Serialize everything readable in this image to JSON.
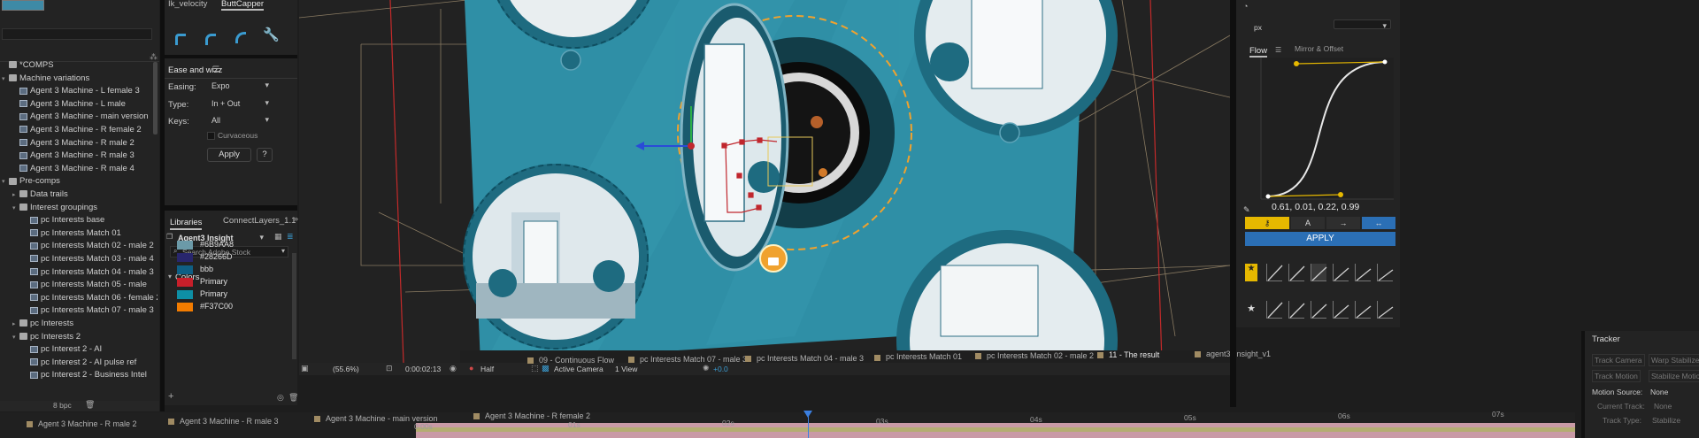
{
  "project_panel": {
    "search_placeholder": "",
    "items": [
      {
        "label": "*COMPS",
        "indent": 0,
        "type": "folder",
        "twirl": ""
      },
      {
        "label": "Machine variations",
        "indent": 0,
        "type": "folder",
        "twirl": "▾"
      },
      {
        "label": "Agent 3 Machine - L female 3",
        "indent": 1,
        "type": "comp",
        "twirl": ""
      },
      {
        "label": "Agent 3 Machine - L male",
        "indent": 1,
        "type": "comp",
        "twirl": ""
      },
      {
        "label": "Agent 3 Machine - main version",
        "indent": 1,
        "type": "comp",
        "twirl": ""
      },
      {
        "label": "Agent 3 Machine - R female 2",
        "indent": 1,
        "type": "comp",
        "twirl": ""
      },
      {
        "label": "Agent 3 Machine - R male 2",
        "indent": 1,
        "type": "comp",
        "twirl": ""
      },
      {
        "label": "Agent 3 Machine - R male 3",
        "indent": 1,
        "type": "comp",
        "twirl": ""
      },
      {
        "label": "Agent 3 Machine - R male 4",
        "indent": 1,
        "type": "comp",
        "twirl": ""
      },
      {
        "label": "Pre-comps",
        "indent": 0,
        "type": "folder",
        "twirl": "▾"
      },
      {
        "label": "Data trails",
        "indent": 1,
        "type": "folder",
        "twirl": "▸"
      },
      {
        "label": "Interest groupings",
        "indent": 1,
        "type": "folder",
        "twirl": "▾"
      },
      {
        "label": "pc Interests base",
        "indent": 2,
        "type": "comp",
        "twirl": ""
      },
      {
        "label": "pc Interests Match 01",
        "indent": 2,
        "type": "comp",
        "twirl": ""
      },
      {
        "label": "pc Interests Match 02 - male 2",
        "indent": 2,
        "type": "comp",
        "twirl": ""
      },
      {
        "label": "pc Interests Match 03 - male 4",
        "indent": 2,
        "type": "comp",
        "twirl": ""
      },
      {
        "label": "pc Interests Match 04 - male 3",
        "indent": 2,
        "type": "comp",
        "twirl": ""
      },
      {
        "label": "pc Interests Match 05 - male",
        "indent": 2,
        "type": "comp",
        "twirl": ""
      },
      {
        "label": "pc Interests Match 06 - female 2",
        "indent": 2,
        "type": "comp",
        "twirl": ""
      },
      {
        "label": "pc Interests Match 07 - male 3",
        "indent": 2,
        "type": "comp",
        "twirl": ""
      },
      {
        "label": "pc Interests",
        "indent": 1,
        "type": "folder",
        "twirl": "▸"
      },
      {
        "label": "pc Interests 2",
        "indent": 1,
        "type": "folder",
        "twirl": "▾"
      },
      {
        "label": "pc Interest 2 - AI",
        "indent": 2,
        "type": "comp",
        "twirl": ""
      },
      {
        "label": "pc Interest 2 - AI pulse ref",
        "indent": 2,
        "type": "comp",
        "twirl": ""
      },
      {
        "label": "pc Interest 2 - Business Intel",
        "indent": 2,
        "type": "comp",
        "twirl": ""
      }
    ],
    "footer_bpc": "8 bpc"
  },
  "scripts_panel": {
    "tabs": [
      "Ik_velocity",
      "ButtCapper"
    ],
    "tool_icons": [
      "corner-icon-1",
      "corner-icon-2",
      "corner-icon-3",
      "wrench-icon"
    ]
  },
  "ease_panel": {
    "title": "Ease and wizz",
    "easing_label": "Easing:",
    "easing_value": "Expo",
    "type_label": "Type:",
    "type_value": "In + Out",
    "keys_label": "Keys:",
    "keys_value": "All",
    "curvaceous_label": "Curvaceous",
    "apply_label": "Apply",
    "help_label": "?"
  },
  "libraries_panel": {
    "tabs": [
      "Libraries",
      "ConnectLayers_1.1"
    ],
    "library_name": "Agent3 Insight",
    "search_placeholder": "Search Adobe Stock",
    "section": "Colors",
    "colors": [
      {
        "label": "#6B9AA8",
        "hex": "#6B9AA8"
      },
      {
        "label": "#28266D",
        "hex": "#28266D"
      },
      {
        "label": "bbb",
        "hex": "#0F5F84"
      },
      {
        "label": "Primary",
        "hex": "#C81F2A"
      },
      {
        "label": "Primary",
        "hex": "#0E8FA5"
      },
      {
        "label": "#F37C00",
        "hex": "#F37C00"
      }
    ]
  },
  "viewer": {
    "zoom": "(55.6%)",
    "timecode": "0:00:02:13",
    "resolution": "Half",
    "camera": "Active Camera",
    "views": "1 View",
    "exposure": "+0.0"
  },
  "flow_panel": {
    "tabs": [
      "Flow",
      "Mirror & Offset"
    ],
    "unit": "px",
    "curve_values": "0.61, 0.01, 0.22, 0.99",
    "apply_label": "APPLY",
    "accent": "#2B6FB5"
  },
  "tracker_panel": {
    "title": "Tracker",
    "buttons": [
      "Track Camera",
      "Warp Stabilizer",
      "Track Motion",
      "Stabilize Motion"
    ],
    "motion_source_label": "Motion Source:",
    "motion_source_value": "None",
    "current_track_label": "Current Track:",
    "current_track_value": "None",
    "track_type_label": "Track Type:",
    "track_type_value": "Stabilize"
  },
  "viewer_tabs": [
    {
      "label": "09 - Continuous Flow"
    },
    {
      "label": "pc Interests Match 07 - male 3"
    },
    {
      "label": "pc Interests Match 04 - male 3"
    },
    {
      "label": "pc Interests Match 01"
    },
    {
      "label": "pc Interests Match 02 - male 2"
    },
    {
      "label": "11 - The result"
    },
    {
      "label": "agent3_insight_v1"
    }
  ],
  "timeline_tabs": [
    {
      "label": "Agent 3 Machine - R male 2"
    },
    {
      "label": "Agent 3 Machine - R male 3"
    },
    {
      "label": "Agent 3 Machine - main version"
    },
    {
      "label": "Agent 3 Machine - R female 2"
    }
  ],
  "ruler_marks": [
    "0:00s",
    "01s",
    "02s",
    "03s",
    "04s",
    "05s",
    "06s",
    "07s"
  ],
  "colors": {
    "scene_bg": "#2F8FA6",
    "ring": "#1E6B80",
    "orange": "#F0A22E",
    "apply_blue": "#2B6FB5",
    "yellow": "#E6B800"
  }
}
